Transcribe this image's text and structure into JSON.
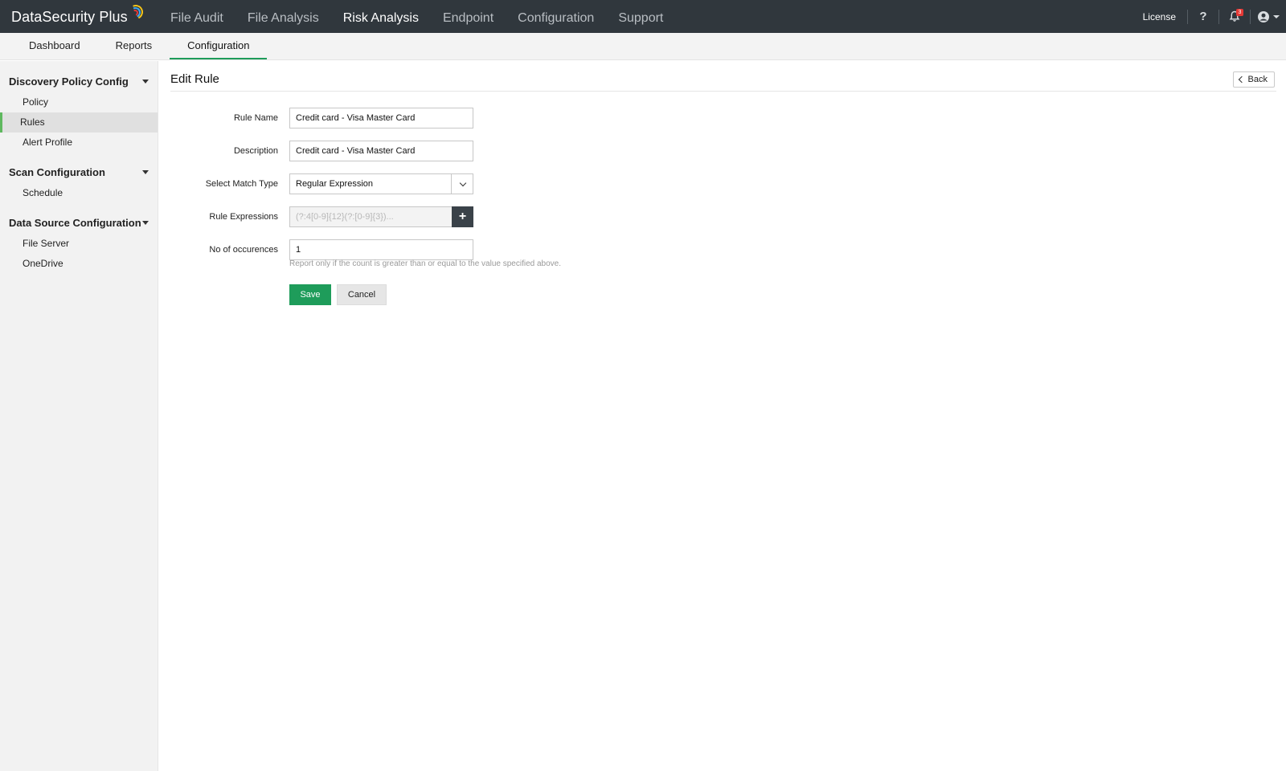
{
  "app": {
    "brand_text": "DataSecurity Plus",
    "brand_colors": [
      "#f5c518",
      "#3fa9f5",
      "#e53935"
    ]
  },
  "main_nav": [
    {
      "label": "File Audit",
      "active": false
    },
    {
      "label": "File Analysis",
      "active": false
    },
    {
      "label": "Risk Analysis",
      "active": true
    },
    {
      "label": "Endpoint",
      "active": false
    },
    {
      "label": "Configuration",
      "active": false
    },
    {
      "label": "Support",
      "active": false
    }
  ],
  "top_right": {
    "license_label": "License",
    "help_glyph": "?",
    "notification_count": "3",
    "icons": [
      "help-icon",
      "bell-icon",
      "user-icon"
    ]
  },
  "sub_nav": [
    {
      "label": "Dashboard",
      "active": false
    },
    {
      "label": "Reports",
      "active": false
    },
    {
      "label": "Configuration",
      "active": true
    }
  ],
  "sidebar": {
    "groups": [
      {
        "title": "Discovery Policy Config",
        "items": [
          {
            "label": "Policy",
            "active": false
          },
          {
            "label": "Rules",
            "active": true
          },
          {
            "label": "Alert Profile",
            "active": false
          }
        ]
      },
      {
        "title": "Scan Configuration",
        "items": [
          {
            "label": "Schedule",
            "active": false
          }
        ]
      },
      {
        "title": "Data Source Configuration",
        "items": [
          {
            "label": "File Server",
            "active": false
          },
          {
            "label": "OneDrive",
            "active": false
          }
        ]
      }
    ]
  },
  "page": {
    "title": "Edit Rule",
    "back_label": "Back"
  },
  "form": {
    "rule_name_label": "Rule Name",
    "rule_name_value": "Credit card - Visa Master Card",
    "description_label": "Description",
    "description_value": "Credit card - Visa Master Card",
    "match_type_label": "Select Match Type",
    "match_type_value": "Regular Expression",
    "rule_expressions_label": "Rule Expressions",
    "rule_expressions_placeholder": "(?:4[0-9]{12}(?:[0-9]{3})...",
    "occurrences_label": "No of occurences",
    "occurrences_value": "1",
    "hint": "Report only if the count is greater than or equal to the value specified above.",
    "save_label": "Save",
    "cancel_label": "Cancel"
  },
  "colors": {
    "topbar": "#30373d",
    "accent_green": "#1e9c5a",
    "active_rule_marker": "#5fb85f",
    "notification_badge": "#e53935"
  }
}
